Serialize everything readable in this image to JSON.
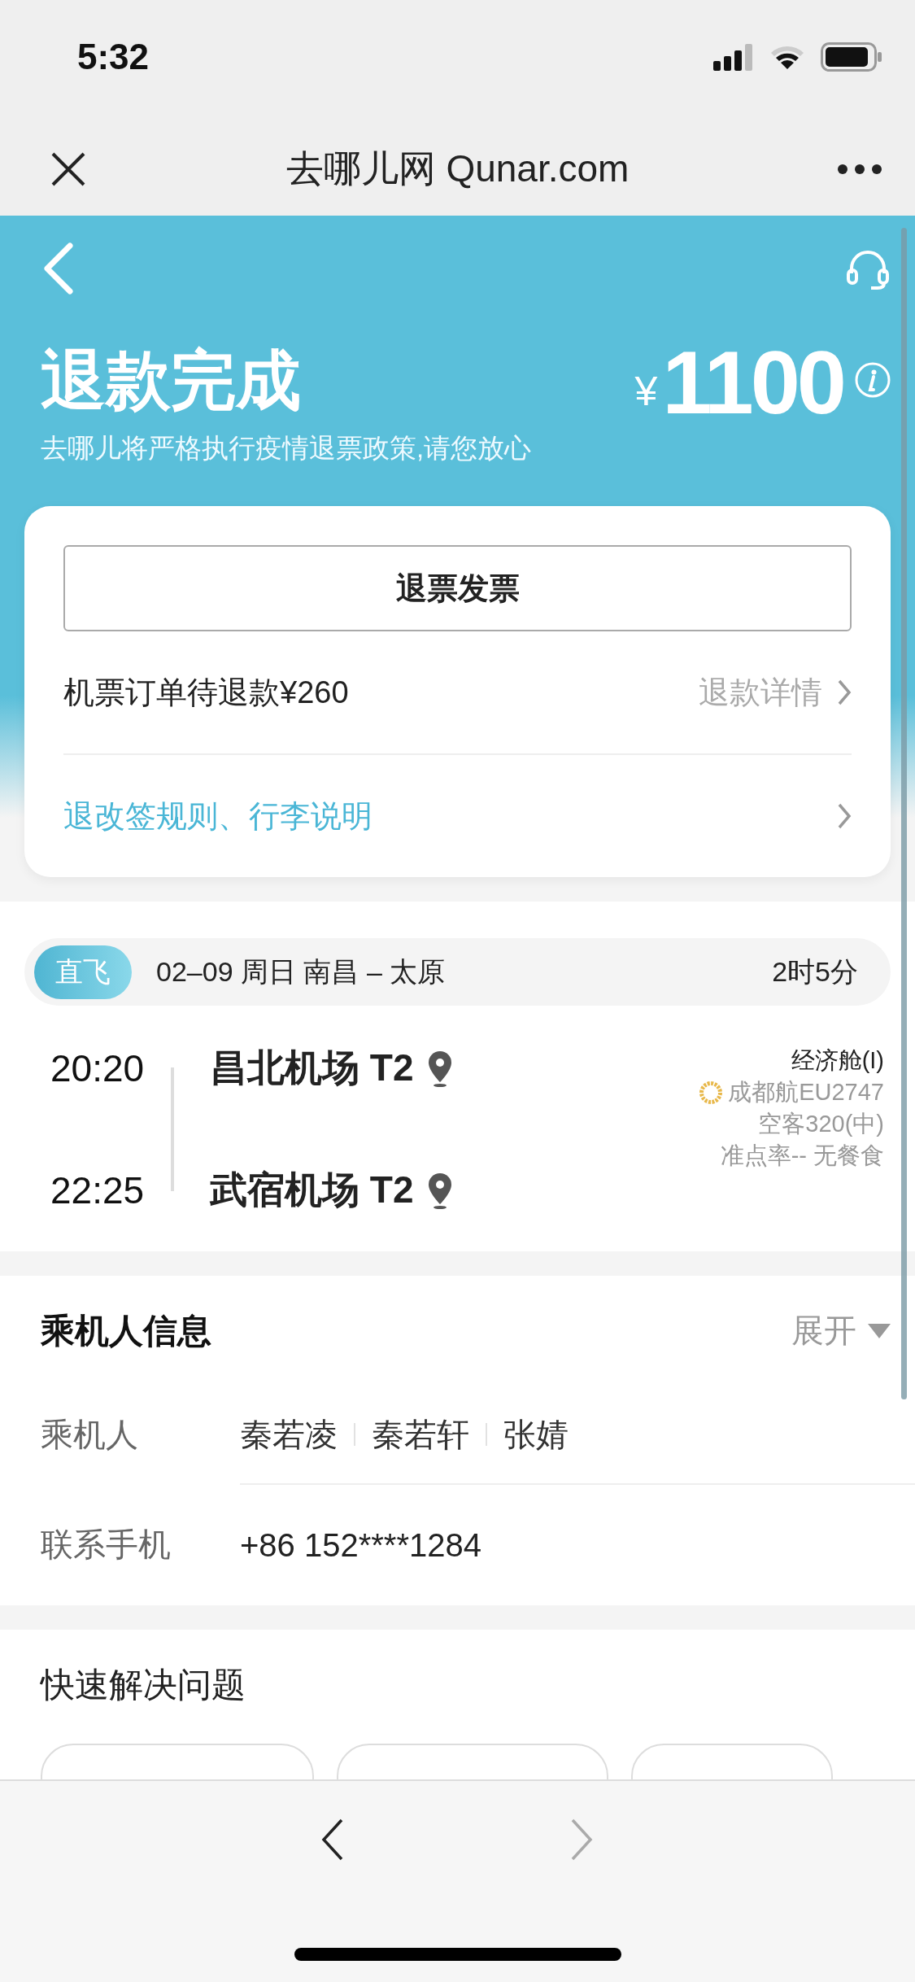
{
  "status_bar": {
    "time": "5:32"
  },
  "browser": {
    "title": "去哪儿网 Qunar.com"
  },
  "refund": {
    "title": "退款完成",
    "currency": "¥",
    "amount": "1100",
    "note": "去哪儿将严格执行疫情退票政策,请您放心"
  },
  "card": {
    "invoice_button": "退票发票",
    "pending": "机票订单待退款¥260",
    "details_link": "退款详情",
    "rules_link": "退改签规则、行李说明"
  },
  "flight": {
    "tag": "直飞",
    "summary": "02–09 周日 南昌 – 太原",
    "duration": "2时5分",
    "segments": [
      {
        "time": "20:20",
        "airport": "昌北机场 T2"
      },
      {
        "time": "22:25",
        "airport": "武宿机场 T2"
      }
    ],
    "cabin": "经济舱(I)",
    "airline": "成都航EU2747",
    "aircraft": "空客320(中)",
    "extras": "准点率-- 无餐食"
  },
  "passengers": {
    "title": "乘机人信息",
    "toggle": "展开",
    "expanded": false,
    "label": "乘机人",
    "names": [
      "秦若凌",
      "秦若轩",
      "张婧"
    ],
    "phone_label": "联系手机",
    "phone": "+86 152****1284"
  },
  "quick": {
    "title": "快速解决问题"
  }
}
